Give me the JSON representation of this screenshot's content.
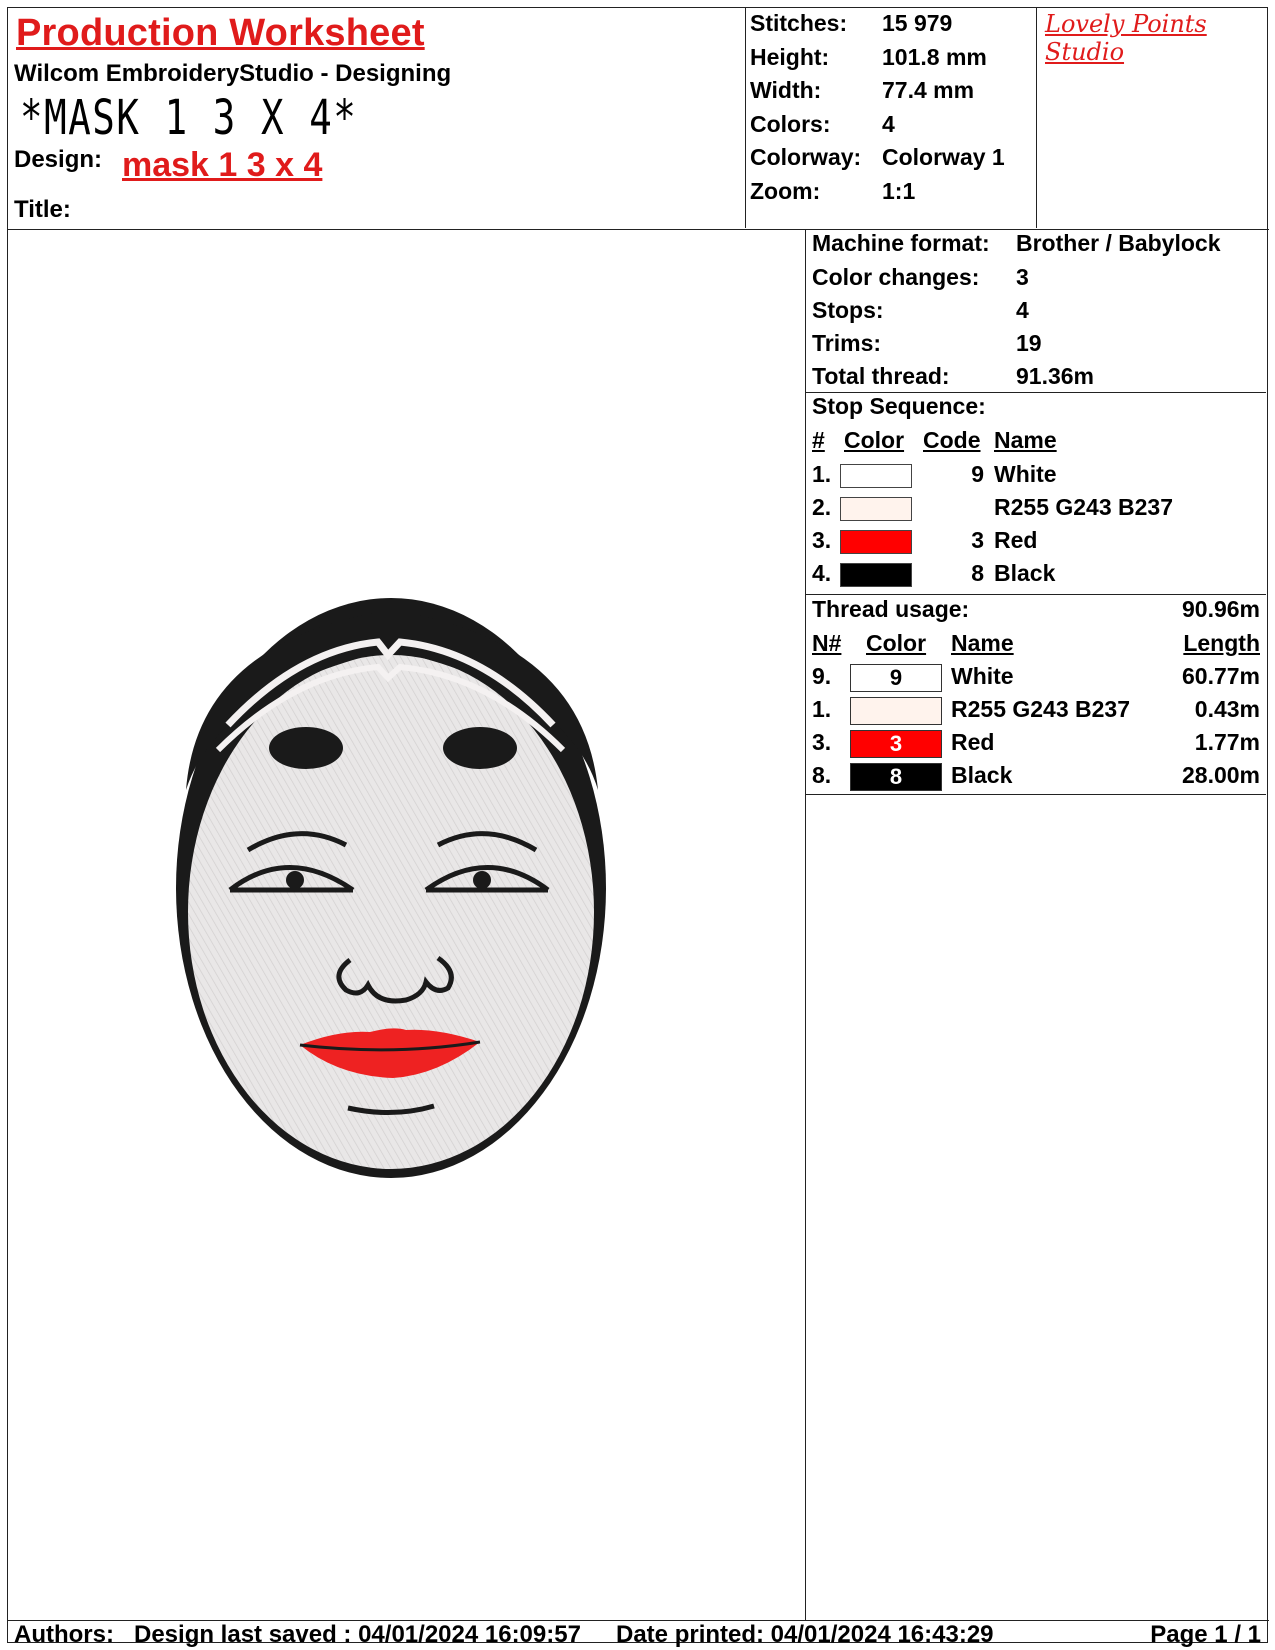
{
  "header": {
    "worksheet_title": "Production Worksheet",
    "software": "Wilcom EmbroideryStudio - Designing",
    "design_filename": "*MASK 1 3 X 4*",
    "design_label": "Design:",
    "design_value": "mask 1 3 x 4",
    "title_label": "Title:",
    "studio": "Lovely Points Studio"
  },
  "stats": {
    "stitches_label": "Stitches:",
    "stitches": "15 979",
    "height_label": "Height:",
    "height": "101.8 mm",
    "width_label": "Width:",
    "width": "77.4 mm",
    "colors_label": "Colors:",
    "colors": "4",
    "colorway_label": "Colorway:",
    "colorway": "Colorway 1",
    "zoom_label": "Zoom:",
    "zoom": "1:1"
  },
  "machine": {
    "format_label": "Machine format:",
    "format": "Brother / Babylock",
    "color_changes_label": "Color changes:",
    "color_changes": "3",
    "stops_label": "Stops:",
    "stops": "4",
    "trims_label": "Trims:",
    "trims": "19",
    "total_thread_label": "Total thread:",
    "total_thread": "91.36m"
  },
  "stop_sequence": {
    "title": "Stop Sequence:",
    "headers": {
      "num": "#",
      "color": "Color",
      "code": "Code",
      "name": "Name"
    },
    "rows": [
      {
        "num": "1.",
        "swatch": "#ffffff",
        "code": "9",
        "name": "White"
      },
      {
        "num": "2.",
        "swatch": "#fff3ed",
        "code": "",
        "name": "R255 G243 B237"
      },
      {
        "num": "3.",
        "swatch": "#ff0000",
        "code": "3",
        "name": "Red"
      },
      {
        "num": "4.",
        "swatch": "#000000",
        "code": "8",
        "name": "Black"
      }
    ]
  },
  "thread_usage": {
    "title": "Thread usage:",
    "total": "90.96m",
    "headers": {
      "num": "N#",
      "color": "Color",
      "name": "Name",
      "length": "Length"
    },
    "rows": [
      {
        "num": "9.",
        "swatch": "#ffffff",
        "code": "9",
        "text_color": "#000000",
        "name": "White",
        "length": "60.77m"
      },
      {
        "num": "1.",
        "swatch": "#fff3ed",
        "code": "",
        "text_color": "#000000",
        "name": "R255 G243 B237",
        "length": "0.43m"
      },
      {
        "num": "3.",
        "swatch": "#ff0000",
        "code": "3",
        "text_color": "#ffffff",
        "name": "Red",
        "length": "1.77m"
      },
      {
        "num": "8.",
        "swatch": "#000000",
        "code": "8",
        "text_color": "#ffffff",
        "name": "Black",
        "length": "28.00m"
      }
    ]
  },
  "footer": {
    "authors": "Authors:",
    "saved": "Design last saved : 04/01/2024 16:09:57",
    "printed": "Date printed: 04/01/2024 16:43:29",
    "page": "Page 1 / 1"
  },
  "colors": {
    "accent_red": "#e01b1b"
  }
}
